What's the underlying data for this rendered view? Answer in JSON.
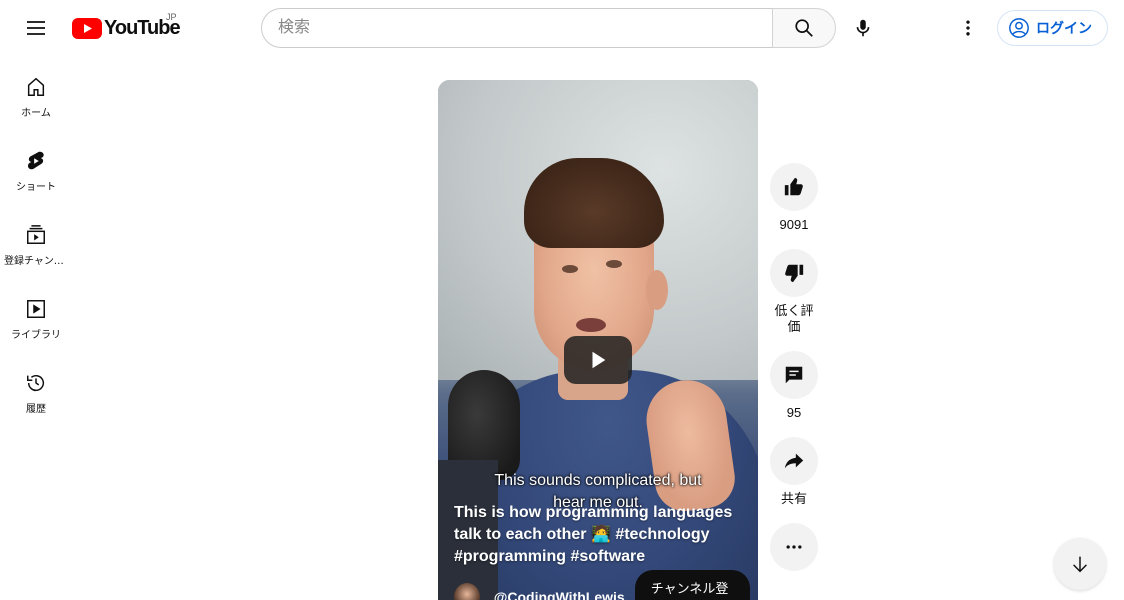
{
  "header": {
    "logo_text": "YouTube",
    "country_code": "JP",
    "search_placeholder": "検索",
    "login_label": "ログイン",
    "icons": {
      "menu": "menu-icon",
      "search": "search-icon",
      "mic": "microphone-icon",
      "more": "more-vertical-icon",
      "account": "account-circle-icon"
    }
  },
  "sidebar": {
    "items": [
      {
        "label": "ホーム",
        "icon": "home-icon"
      },
      {
        "label": "ショート",
        "icon": "shorts-icon"
      },
      {
        "label": "登録チャンネル",
        "icon": "subscriptions-icon"
      },
      {
        "label": "ライブラリ",
        "icon": "library-icon"
      },
      {
        "label": "履歴",
        "icon": "history-icon"
      }
    ]
  },
  "video": {
    "caption": "This sounds complicated, but hear me out.",
    "title_text": "This is how programming languages talk to each other",
    "title_emoji": "🧑‍💻",
    "hashtags": [
      "#technology",
      "#programming",
      "#software"
    ],
    "channel_name": "@CodingWithLewis",
    "subscribe_label": "チャンネル登録"
  },
  "actions": {
    "like_count": "9091",
    "dislike_label": "低く評価",
    "comment_count": "95",
    "share_label": "共有"
  },
  "colors": {
    "brand_red": "#ff0000",
    "link_blue": "#065fd4",
    "action_bg": "#f2f2f2"
  }
}
